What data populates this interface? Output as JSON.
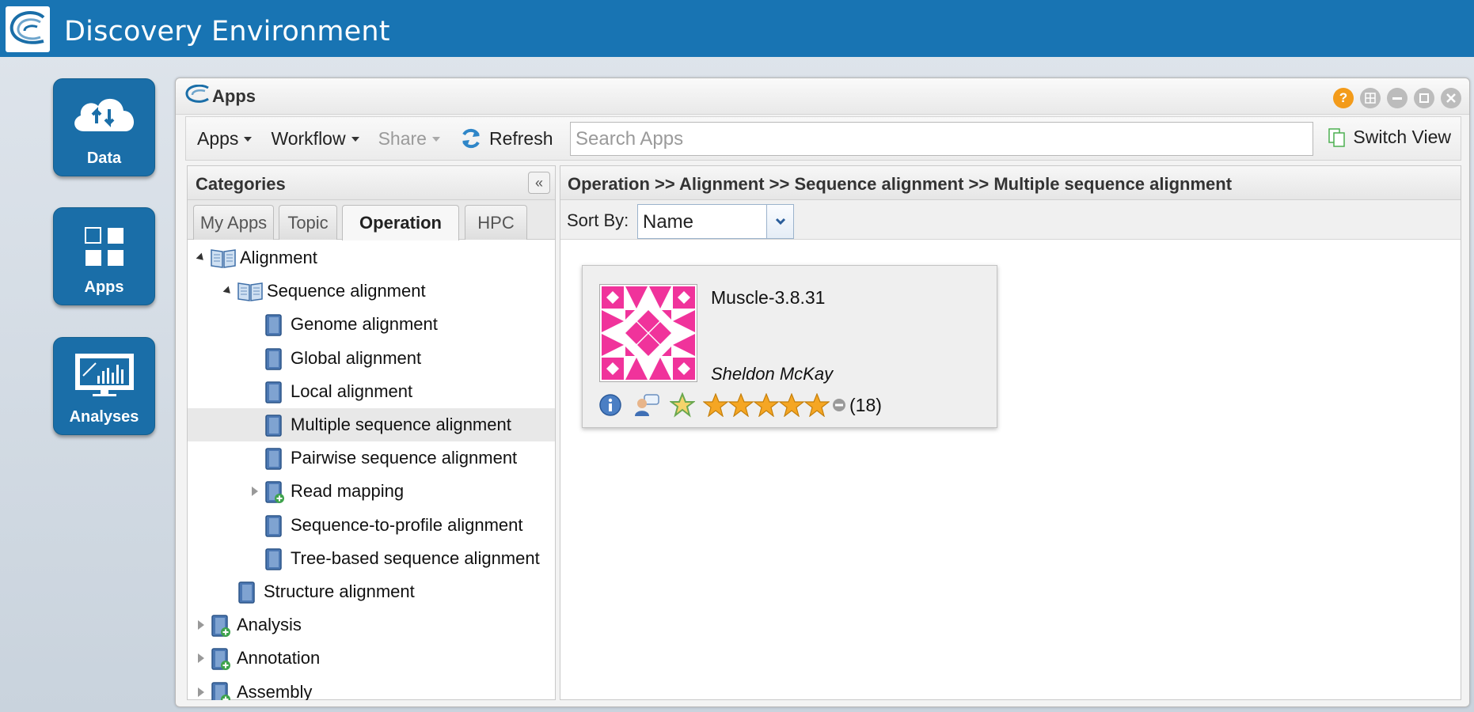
{
  "header": {
    "title": "Discovery Environment"
  },
  "launcher": [
    {
      "label": "Data",
      "icon": "cloud-upload-download-icon"
    },
    {
      "label": "Apps",
      "icon": "grid-icon"
    },
    {
      "label": "Analyses",
      "icon": "monitor-chart-icon"
    }
  ],
  "window": {
    "title": "Apps",
    "controls": [
      "help-icon",
      "layout-icon",
      "minimize-icon",
      "maximize-icon",
      "close-icon"
    ]
  },
  "toolbar": {
    "apps_label": "Apps",
    "workflow_label": "Workflow",
    "share_label": "Share",
    "refresh_label": "Refresh",
    "search_placeholder": "Search Apps",
    "switch_view_label": "Switch View"
  },
  "categories": {
    "title": "Categories",
    "tabs": [
      {
        "label": "My Apps",
        "active": false
      },
      {
        "label": "Topic",
        "active": false
      },
      {
        "label": "Operation",
        "active": true
      },
      {
        "label": "HPC",
        "active": false
      }
    ],
    "tree": [
      {
        "label": "Alignment",
        "level": 0,
        "expanded": true,
        "type": "open-book"
      },
      {
        "label": "Sequence alignment",
        "level": 1,
        "expanded": true,
        "type": "open-book"
      },
      {
        "label": "Genome alignment",
        "level": 2,
        "type": "book"
      },
      {
        "label": "Global alignment",
        "level": 2,
        "type": "book"
      },
      {
        "label": "Local alignment",
        "level": 2,
        "type": "book"
      },
      {
        "label": "Multiple sequence alignment",
        "level": 2,
        "type": "book",
        "selected": true
      },
      {
        "label": "Pairwise sequence alignment",
        "level": 2,
        "type": "book"
      },
      {
        "label": "Read mapping",
        "level": 2,
        "type": "book-plus",
        "collapsed": true
      },
      {
        "label": "Sequence-to-profile alignment",
        "level": 2,
        "type": "book"
      },
      {
        "label": "Tree-based sequence alignment",
        "level": 2,
        "type": "book"
      },
      {
        "label": "Structure alignment",
        "level": 1,
        "type": "book"
      },
      {
        "label": "Analysis",
        "level": 0,
        "type": "book-plus",
        "collapsed": true
      },
      {
        "label": "Annotation",
        "level": 0,
        "type": "book-plus",
        "collapsed": true
      },
      {
        "label": "Assembly",
        "level": 0,
        "type": "book-plus",
        "collapsed": true
      }
    ]
  },
  "main": {
    "breadcrumb": "Operation >> Alignment >> Sequence alignment >> Multiple sequence alignment",
    "sort_label": "Sort By:",
    "sort_value": "Name",
    "card": {
      "name": "Muscle-3.8.31",
      "author": "Sheldon McKay",
      "rating_stars": 5,
      "rating_count": "(18)",
      "icons": [
        "info-icon",
        "comment-user-icon",
        "favorite-star-icon"
      ]
    }
  },
  "colors": {
    "topbar": "#1874b3",
    "launcher": "#1a6ea8",
    "identicon": "#f0339b",
    "star": "#f5a623"
  }
}
